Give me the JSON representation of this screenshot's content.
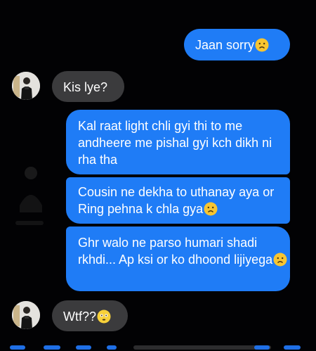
{
  "conversation": {
    "messages": [
      {
        "from": "me",
        "text": "Jaan sorry",
        "emoji": "frown-face"
      },
      {
        "from": "them",
        "text": "Kis lye?"
      },
      {
        "from": "me",
        "text": "Kal raat light chli gyi thi to me andheere me pishal gyi kch dikh ni rha tha"
      },
      {
        "from": "me",
        "text": "Cousin ne dekha to uthanay aya or Ring pehna k chla gya",
        "emoji": "frown-face"
      },
      {
        "from": "me",
        "text": "Ghr walo ne parso humari shadi rkhdi... Ap ksi or ko dhoond lijiyega",
        "emoji": "frown-face"
      },
      {
        "from": "them",
        "text": "Wtf??",
        "emoji": "flushed-face"
      }
    ]
  },
  "colors": {
    "sent_bubble": "#1f7cf6",
    "received_bubble": "#3b3b3d",
    "background": "#020204"
  }
}
